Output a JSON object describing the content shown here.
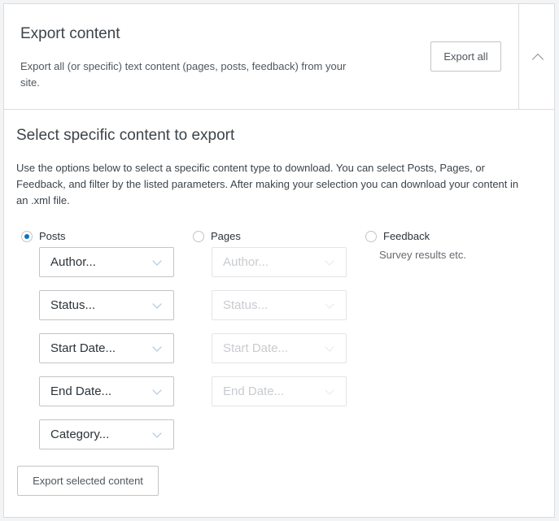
{
  "header": {
    "title": "Export content",
    "description": "Export all (or specific) text content (pages, posts, feedback) from your site.",
    "export_all_label": "Export all",
    "toggle_icon": "chevron-up-icon"
  },
  "section": {
    "title": "Select specific content to export",
    "description": "Use the options below to select a specific content type to download. You can select Posts, Pages, or Feedback, and filter by the listed parameters. After making your selection you can download your content in an .xml file."
  },
  "content_types": [
    {
      "label": "Posts",
      "selected": true,
      "filters": [
        "Author...",
        "Status...",
        "Start Date...",
        "End Date...",
        "Category..."
      ]
    },
    {
      "label": "Pages",
      "selected": false,
      "filters": [
        "Author...",
        "Status...",
        "Start Date...",
        "End Date..."
      ]
    },
    {
      "label": "Feedback",
      "selected": false,
      "description": "Survey results etc."
    }
  ],
  "export_selected_label": "Export selected content",
  "colors": {
    "accent": "#0675c4",
    "border": "#c3c4c7",
    "disabled_text": "#c8cbcf"
  }
}
